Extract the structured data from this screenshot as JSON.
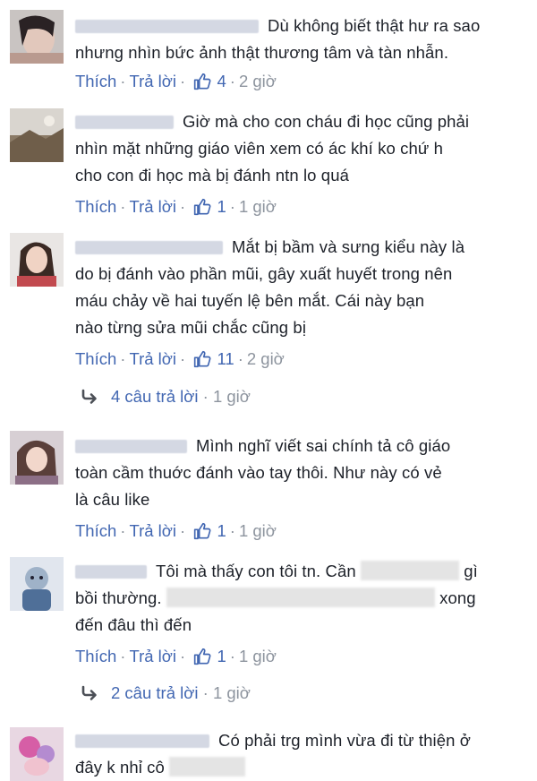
{
  "comments": [
    {
      "text_lines": [
        "Dù không biết thật hư ra sao",
        "nhưng nhìn bức ảnh thật thương tâm và tàn nhẫn."
      ],
      "like_label": "Thích",
      "reply_label": "Trả lời",
      "likes": "4",
      "time": "2 giờ"
    },
    {
      "text_lines": [
        "Giờ mà cho con cháu đi học cũng phải",
        "nhìn mặt những giáo viên xem có ác khí ko chứ h",
        "cho con đi học mà bị đánh ntn lo quá"
      ],
      "like_label": "Thích",
      "reply_label": "Trả lời",
      "likes": "1",
      "time": "1 giờ"
    },
    {
      "text_lines": [
        "Mắt bị bầm và sưng kiểu này là",
        "do bị đánh vào phần mũi, gây xuất huyết trong nên",
        "máu chảy về hai tuyến lệ bên mắt. Cái này bạn",
        "nào từng sửa mũi chắc cũng bị"
      ],
      "like_label": "Thích",
      "reply_label": "Trả lời",
      "likes": "11",
      "time": "2 giờ",
      "replies_label": "4 câu trả lời",
      "replies_time": "1 giờ"
    },
    {
      "text_lines": [
        "Mình nghĩ viết sai chính tả cô giáo",
        "toàn cầm thuớc đánh vào tay thôi. Như này có vẻ",
        "là câu like"
      ],
      "like_label": "Thích",
      "reply_label": "Trả lời",
      "likes": "1",
      "time": "1 giờ"
    },
    {
      "text_a": "Tôi mà thấy con tôi tn. Cần",
      "text_b": "gì",
      "text_c": "bồi thường.",
      "text_d": "xong",
      "text_e": "đến đâu thì đến",
      "like_label": "Thích",
      "reply_label": "Trả lời",
      "likes": "1",
      "time": "1 giờ",
      "replies_label": "2 câu trả lời",
      "replies_time": "1 giờ"
    },
    {
      "text_a": "Có phải trg mình vừa đi từ thiện ở",
      "text_b": "đây k nhỉ cô"
    }
  ],
  "icons": {
    "like": "thumbs-up-icon",
    "reply_arrow": "reply-arrow-icon"
  },
  "colors": {
    "link": "#4267b2",
    "meta": "#8d949e",
    "text": "#1d2129"
  }
}
